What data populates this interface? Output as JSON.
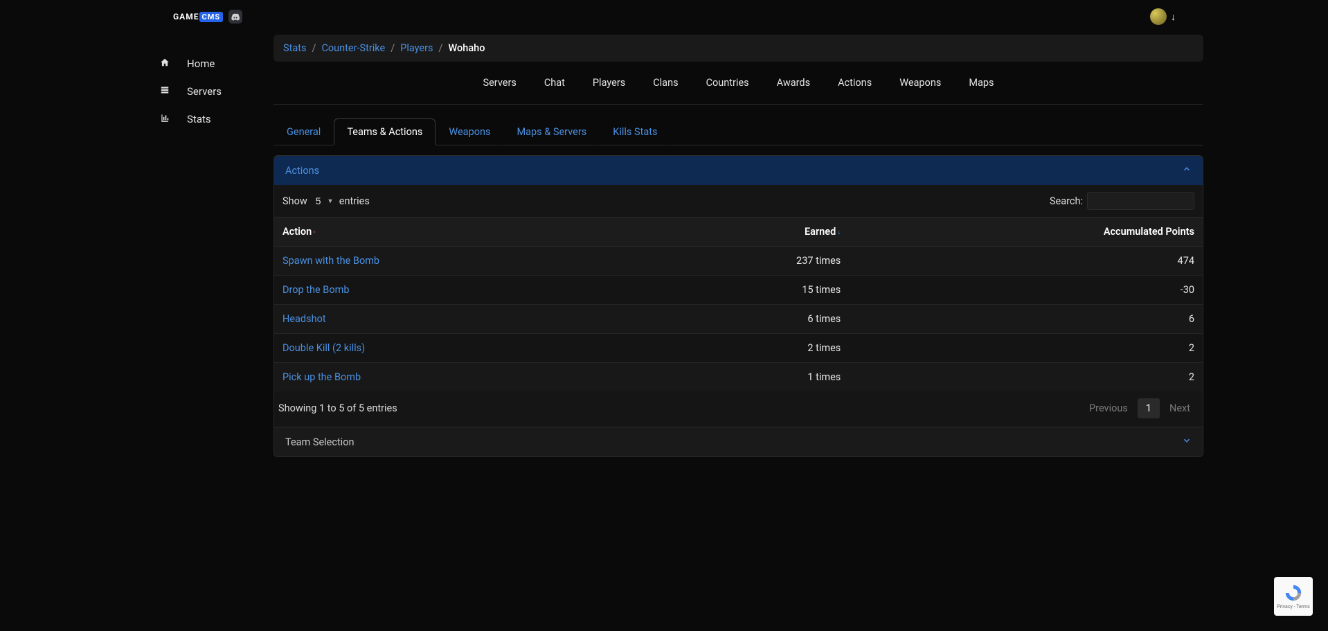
{
  "brand": {
    "prefix": "GAME",
    "suffix": "CMS"
  },
  "sidebar": {
    "items": [
      {
        "label": "Home"
      },
      {
        "label": "Servers"
      },
      {
        "label": "Stats"
      }
    ]
  },
  "breadcrumb": {
    "items": [
      "Stats",
      "Counter-Strike",
      "Players"
    ],
    "current": "Wohaho"
  },
  "nav": [
    "Servers",
    "Chat",
    "Players",
    "Clans",
    "Countries",
    "Awards",
    "Actions",
    "Weapons",
    "Maps"
  ],
  "subtabs": [
    "General",
    "Teams & Actions",
    "Weapons",
    "Maps & Servers",
    "Kills Stats"
  ],
  "panels": {
    "actions_title": "Actions",
    "team_selection_title": "Team Selection"
  },
  "dt": {
    "show_label_pre": "Show",
    "show_label_post": "entries",
    "show_value": "5",
    "search_label": "Search:",
    "columns": [
      "Action",
      "Earned",
      "Accumulated Points"
    ],
    "rows": [
      {
        "action": "Spawn with the Bomb",
        "earned": "237 times",
        "accum": "474"
      },
      {
        "action": "Drop the Bomb",
        "earned": "15 times",
        "accum": "-30"
      },
      {
        "action": "Headshot",
        "earned": "6 times",
        "accum": "6"
      },
      {
        "action": "Double Kill (2 kills)",
        "earned": "2 times",
        "accum": "2"
      },
      {
        "action": "Pick up the Bomb",
        "earned": "1 times",
        "accum": "2"
      }
    ],
    "info": "Showing 1 to 5 of 5 entries",
    "pager": {
      "prev": "Previous",
      "page": "1",
      "next": "Next"
    }
  },
  "recaptcha": {
    "footer": "Privacy - Terms"
  }
}
